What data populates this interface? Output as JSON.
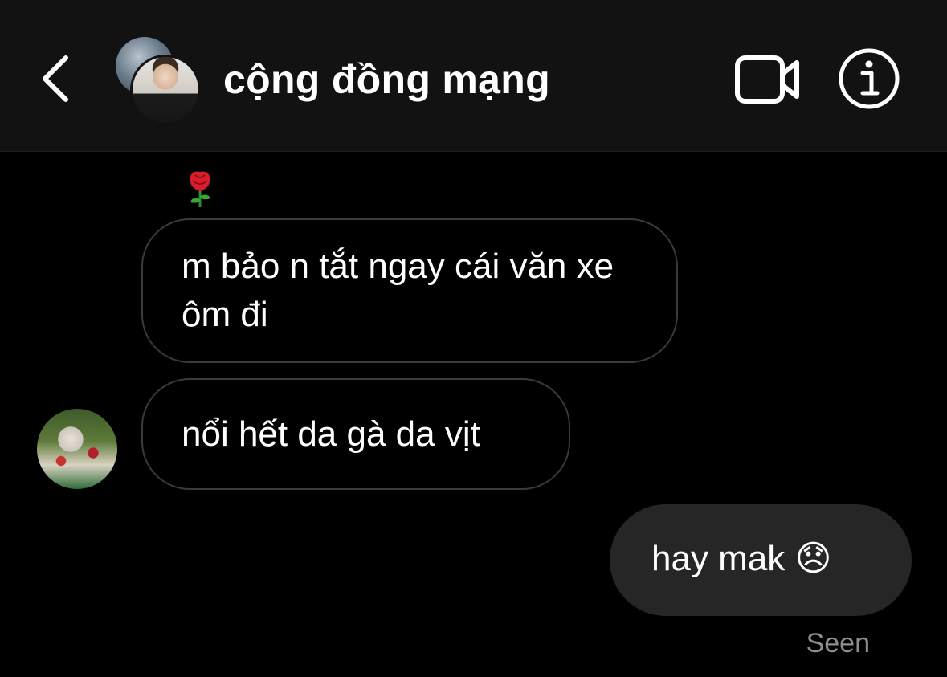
{
  "header": {
    "title": "cộng đồng mạng",
    "back_icon": "chevron-left-icon",
    "video_icon": "video-camera-icon",
    "info_icon": "info-icon"
  },
  "messages": [
    {
      "direction": "incoming",
      "text": "m bảo n tắt ngay cái văn xe ôm đi",
      "reaction": "🌹"
    },
    {
      "direction": "incoming",
      "text": "nổi hết da gà da vịt"
    },
    {
      "direction": "outgoing",
      "text": "hay mak 😞",
      "status": "Seen"
    }
  ],
  "colors": {
    "background": "#000000",
    "header_bg": "#121212",
    "incoming_border": "#3a3a3a",
    "outgoing_bg": "#262626",
    "seen_text": "#8e8e8e"
  }
}
